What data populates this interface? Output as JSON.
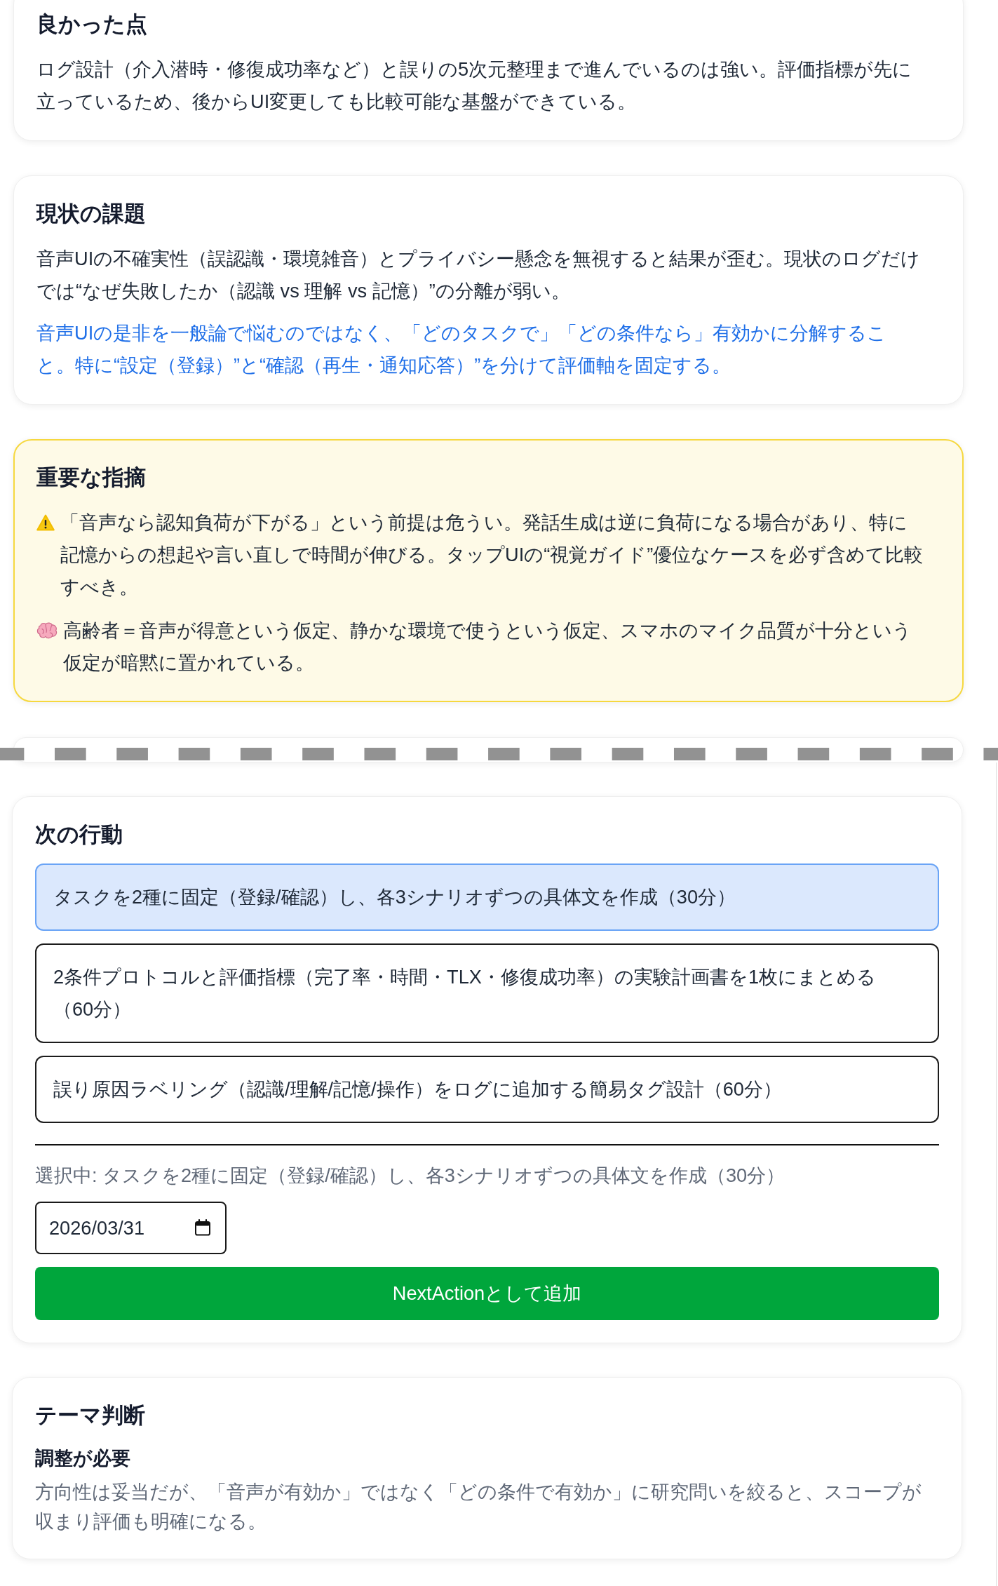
{
  "strengths": {
    "title": "良かった点",
    "text": "ログ設計（介入潜時・修復成功率など）と誤りの5次元整理まで進んでいるのは強い。評価指標が先に立っているため、後からUI変更しても比較可能な基盤ができている。"
  },
  "issues": {
    "title": "現状の課題",
    "text": "音声UIの不確実性（誤認識・環境雑音）とプライバシー懸念を無視すると結果が歪む。現状のログだけでは“なぜ失敗したか（認識 vs 理解 vs 記憶）”の分離が弱い。",
    "advice": "音声UIの是非を一般論で悩むのではなく、「どのタスクで」「どの条件なら」有効かに分解すること。特に“設定（登録）”と“確認（再生・通知応答）”を分けて評価軸を固定する。"
  },
  "critical_points": {
    "title": "重要な指摘",
    "items": [
      {
        "kind": "warning",
        "text": "「音声なら認知負荷が下がる」という前提は危うい。発話生成は逆に負荷になる場合があり、特に記憶からの想起や言い直しで時間が伸びる。タップUIの“視覚ガイド”優位なケースを必ず含めて比較すべき。"
      },
      {
        "kind": "assumption",
        "text": "高齢者＝音声が得意という仮定、静かな環境で使うという仮定、スマホのマイク品質が十分という仮定が暗黙に置かれている。"
      }
    ]
  },
  "next_actions": {
    "title": "次の行動",
    "options": [
      {
        "text": "タスクを2種に固定（登録/確認）し、各3シナリオずつの具体文を作成（30分）",
        "selected": true
      },
      {
        "text": "2条件プロトコルと評価指標（完了率・時間・TLX・修復成功率）の実験計画書を1枚にまとめる（60分）",
        "selected": false
      },
      {
        "text": "誤り原因ラベリング（認識/理解/記憶/操作）をログに追加する簡易タグ設計（60分）",
        "selected": false
      }
    ],
    "selection_label": "選択中: タスクを2種に固定（登録/確認）し、各3シナリオずつの具体文を作成（30分）",
    "due_date": {
      "value": "2026/03/31"
    },
    "add_button": "NextActionとして追加"
  },
  "theme_judgment": {
    "title": "テーマ判断",
    "verdict": "調整が必要",
    "text": "方向性は妥当だが、「音声が有効か」ではなく「どの条件で有効か」に研究問いを絞ると、スコープが収まり評価も明確になる。"
  }
}
